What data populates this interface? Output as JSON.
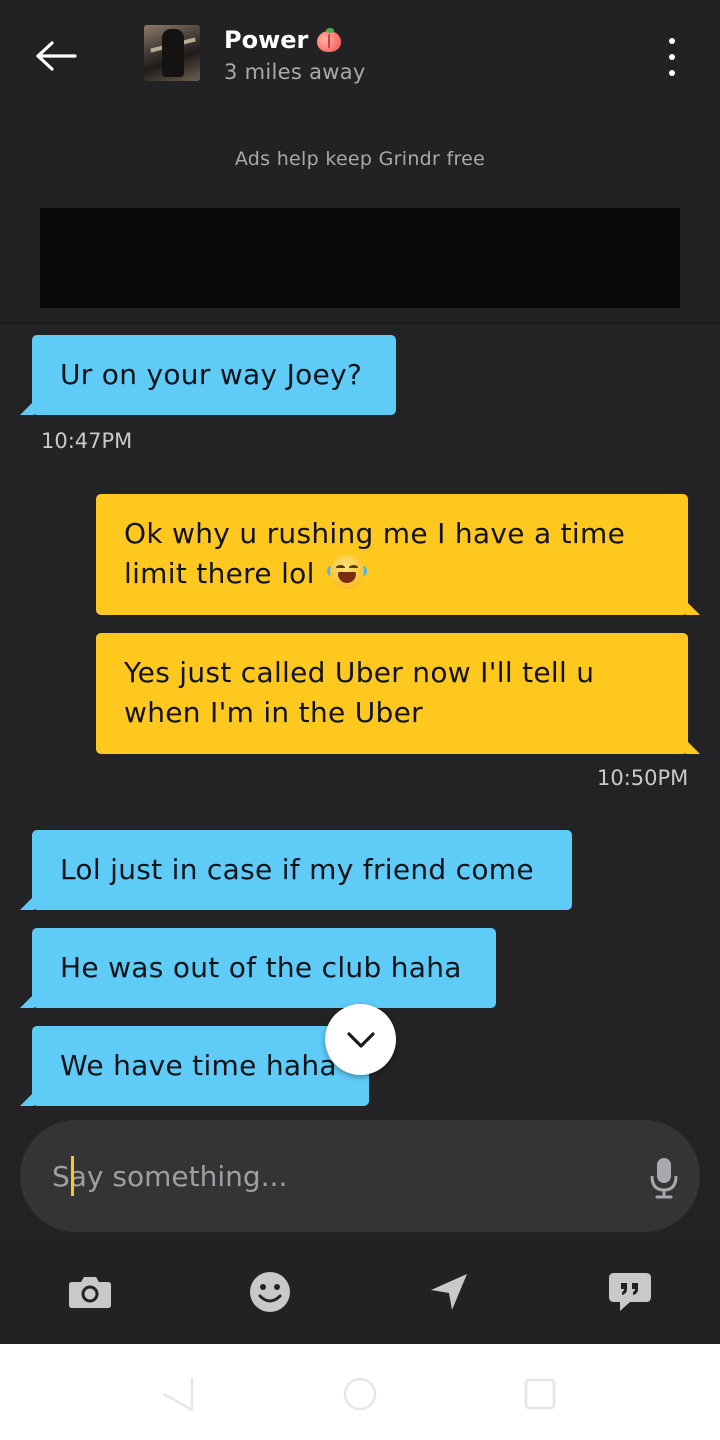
{
  "header": {
    "back_icon": "arrow-left-icon",
    "profile_name": "Power",
    "name_emoji": "peach-emoji",
    "distance": "3 miles away",
    "more_icon": "vertical-dots-icon"
  },
  "ad": {
    "text": "Ads help keep Grindr free"
  },
  "messages": [
    {
      "side": "in",
      "text": "Ur on your way Joey?"
    },
    {
      "timestamp": "10:47PM"
    },
    {
      "side": "out",
      "text_line1": "Ok why u rushing me I have a time",
      "text_line2": "limit there lol",
      "emoji": "face-with-tears-of-joy"
    },
    {
      "side": "out",
      "text_line1": "Yes just called Uber now I'll tell u",
      "text_line2": "when I'm in the Uber"
    },
    {
      "timestamp": "10:50PM"
    },
    {
      "side": "in",
      "text": "Lol just in case if my friend come"
    },
    {
      "side": "in",
      "text": "He was out of the club haha"
    },
    {
      "side": "in",
      "text": "We have time haha"
    }
  ],
  "composer": {
    "placeholder": "Say something...",
    "mic_icon": "microphone-icon"
  },
  "toolbar": {
    "items": [
      "camera-icon",
      "smiley-icon",
      "location-arrow-icon",
      "saved-phrases-icon"
    ]
  },
  "colors": {
    "background": "#232326",
    "incoming_bubble": "#5fcbf7",
    "outgoing_bubble": "#ffc81e",
    "composer": "#343437"
  }
}
